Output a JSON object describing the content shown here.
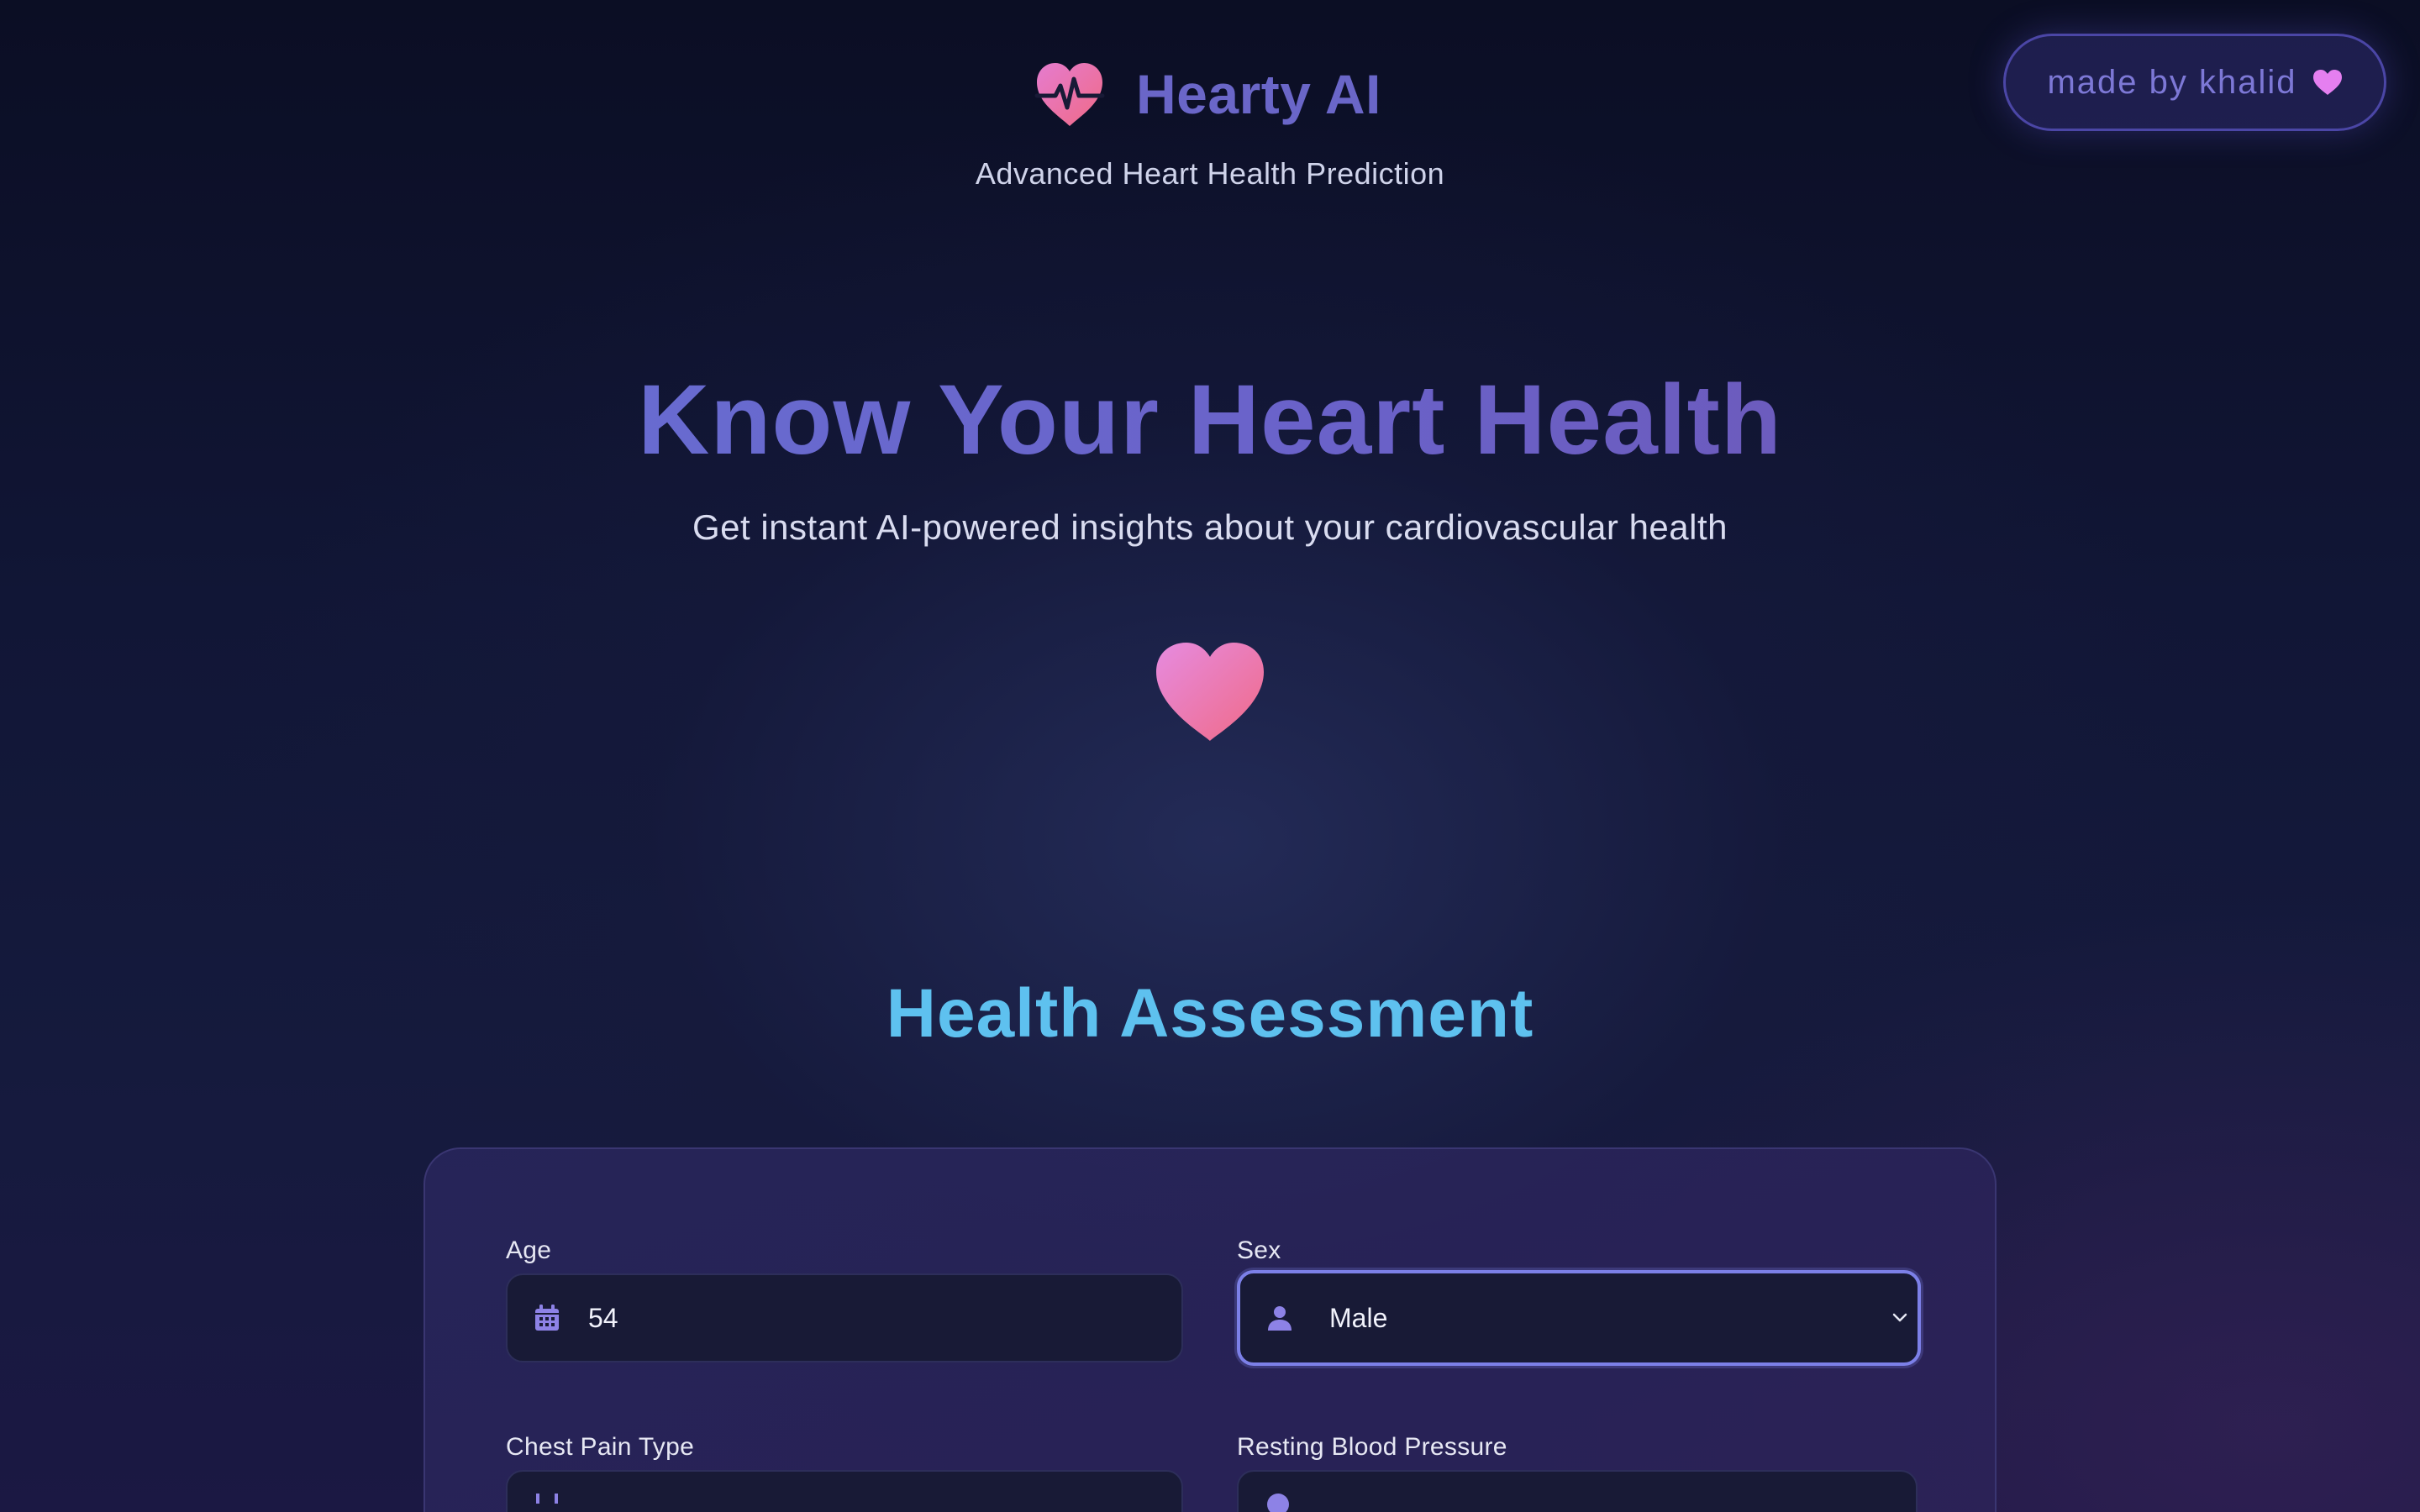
{
  "header": {
    "brand_name": "Hearty AI",
    "brand_subtitle": "Advanced Heart Health Prediction",
    "made_by": "made by khalid"
  },
  "hero": {
    "title": "Know Your Heart Health",
    "subtitle": "Get instant AI-powered insights about your cardiovascular health"
  },
  "section": {
    "title": "Health Assessment"
  },
  "form": {
    "age": {
      "label": "Age",
      "value": "54",
      "icon": "calendar-icon"
    },
    "sex": {
      "label": "Sex",
      "value": "Male",
      "icon": "user-icon"
    },
    "chest_pain": {
      "label": "Chest Pain Type",
      "icon": "list-icon"
    },
    "resting_bp": {
      "label": "Resting Blood Pressure",
      "icon": "gauge-icon"
    }
  },
  "colors": {
    "brand": "#6a66c8",
    "accent_blue": "#5ec1ef",
    "heart_pink": "#ee6ea0",
    "focus": "#7c80e8"
  }
}
